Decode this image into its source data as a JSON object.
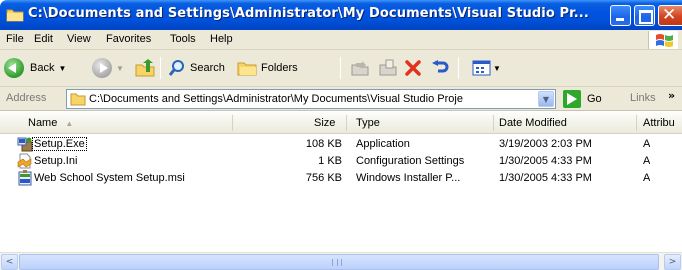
{
  "window": {
    "title": "C:\\Documents and Settings\\Administrator\\My Documents\\Visual Studio Pr..."
  },
  "menu": {
    "items": [
      "File",
      "Edit",
      "View",
      "Favorites",
      "Tools",
      "Help"
    ]
  },
  "toolbar": {
    "back_label": "Back",
    "search_label": "Search",
    "folders_label": "Folders"
  },
  "address": {
    "label": "Address",
    "path": "C:\\Documents and Settings\\Administrator\\My Documents\\Visual Studio Proje",
    "go_label": "Go",
    "links_label": "Links",
    "links_chevron": "»"
  },
  "list": {
    "columns": [
      "Name",
      "Size",
      "Type",
      "Date Modified",
      "Attribu"
    ],
    "rows": [
      {
        "name": "Setup.Exe",
        "size": "108 KB",
        "type": "Application",
        "date": "3/19/2003 2:03 PM",
        "attr": "A",
        "icon": "setup-exe-icon"
      },
      {
        "name": "Setup.Ini",
        "size": "1 KB",
        "type": "Configuration Settings",
        "date": "1/30/2005 4:33 PM",
        "attr": "A",
        "icon": "ini-file-icon"
      },
      {
        "name": "Web School System Setup.msi",
        "size": "756 KB",
        "type": "Windows Installer P...",
        "date": "1/30/2005 4:33 PM",
        "attr": "A",
        "icon": "msi-installer-icon"
      }
    ]
  },
  "scrollbar": {
    "left_arrow": "<",
    "right_arrow": ">"
  },
  "colors": {
    "titlebar": "#0054e3",
    "chrome": "#ece9d8",
    "close_button": "#d1461f",
    "go_button": "#2ea82b"
  }
}
